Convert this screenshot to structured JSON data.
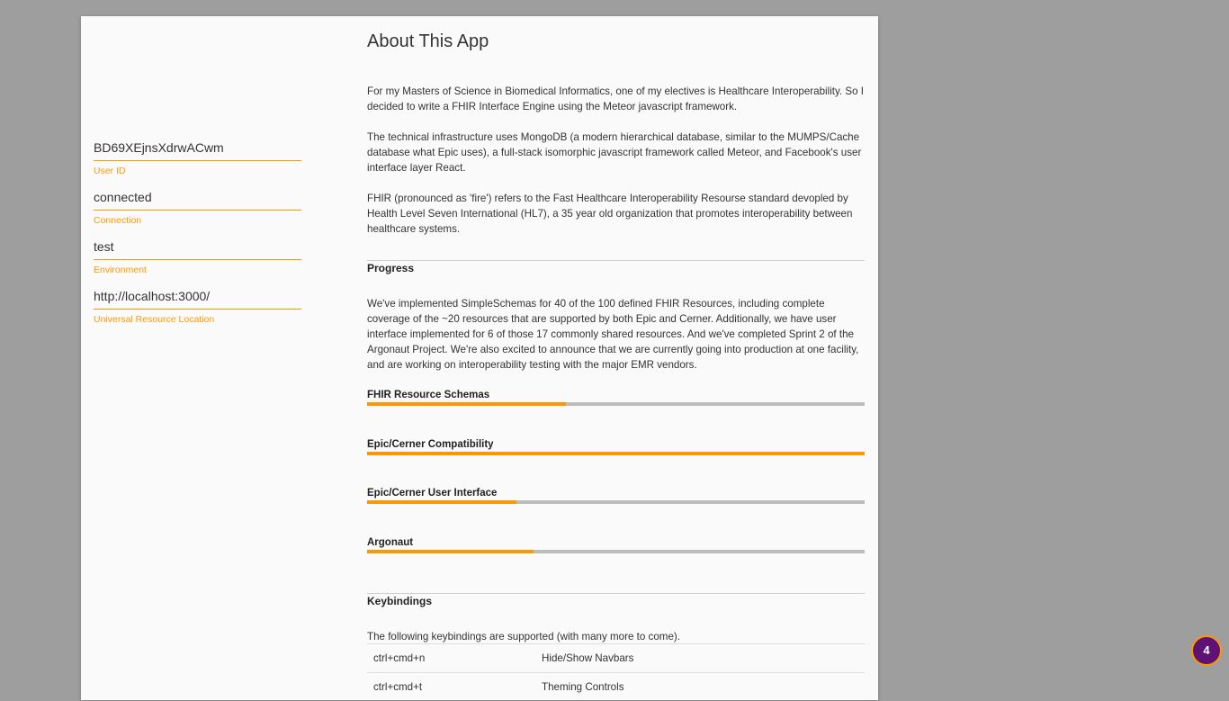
{
  "sidebar": {
    "fields": [
      {
        "value": "BD69XEjnsXdrwACwm",
        "label": "User ID"
      },
      {
        "value": "connected",
        "label": "Connection"
      },
      {
        "value": "test",
        "label": "Environment"
      },
      {
        "value": "http://localhost:3000/",
        "label": "Universal Resource Location"
      }
    ]
  },
  "main": {
    "title": "About This App",
    "intro": [
      "For my Masters of Science in Biomedical Informatics, one of my electives is Healthcare Interoperability. So I decided to write a FHIR Interface Engine using the Meteor javascript framework.",
      "The technical infrastructure uses MongoDB (a modern hierarchical database, similar to the MUMPS/Cache database what Epic uses), a full-stack isomorphic javascript framework called Meteor, and Facebook's user interface layer React.",
      "FHIR (pronounced as 'fire') refers to the Fast Healthcare Interoperability Resourse standard devopled by Health Level Seven International (HL7), a 35 year old organization that promotes interoperability between healthcare systems."
    ],
    "progress": {
      "heading": "Progress",
      "text": "We've implemented SimpleSchemas for 40 of the 100 defined FHIR Resources, including complete coverage of the ~20 resources that are supported by both Epic and Cerner. Additionally, we have user interface implemented for 6 of those 17 commonly shared resources. And we've completed Sprint 2 of the Argonaut Project. We're also excited to announce that we are currently going into production at one facility, and are working on interoperability testing with the major EMR vendors.",
      "bars": [
        {
          "label": "FHIR Resource Schemas",
          "percent": 40
        },
        {
          "label": "Epic/Cerner Compatibility",
          "percent": 100
        },
        {
          "label": "Epic/Cerner User Interface",
          "percent": 30
        },
        {
          "label": "Argonaut",
          "percent": 33.5
        }
      ]
    },
    "keybindings": {
      "heading": "Keybindings",
      "intro": "The following keybindings are supported (with many more to come).",
      "rows": [
        {
          "keys": "ctrl+cmd+n",
          "action": "Hide/Show Navbars"
        },
        {
          "keys": "ctrl+cmd+t",
          "action": "Theming Controls"
        }
      ]
    }
  },
  "badge": {
    "count": "4"
  },
  "colors": {
    "accent": "#ff9800",
    "badge": "#5e1273",
    "background": "#9e9e9e",
    "card": "#fafafa"
  }
}
